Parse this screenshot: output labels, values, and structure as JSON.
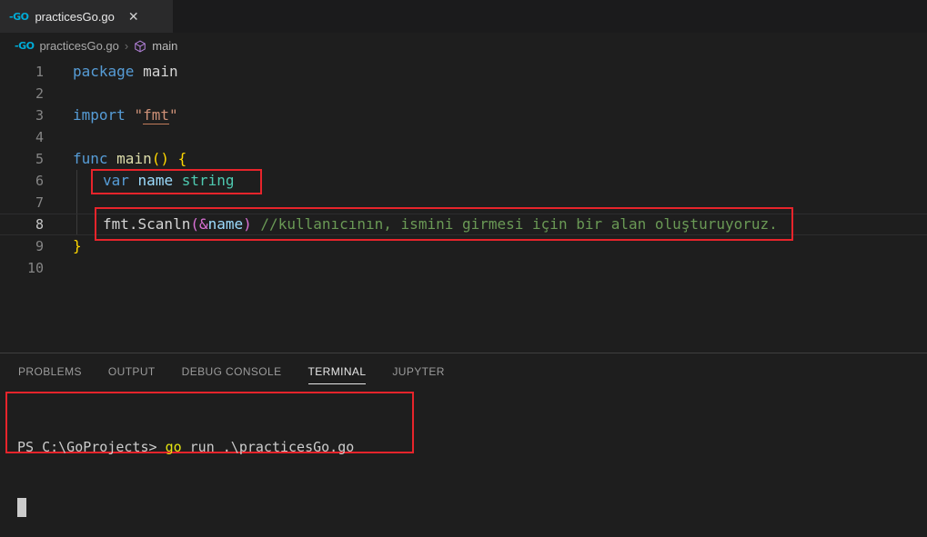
{
  "tab": {
    "filename": "practicesGo.go",
    "close_glyph": "✕",
    "go_icon_text": "-GO"
  },
  "breadcrumb": {
    "file": "practicesGo.go",
    "separator": "›",
    "symbol": "main"
  },
  "editor": {
    "lines": [
      {
        "n": "1",
        "indent": 0,
        "tokens": [
          [
            "kw",
            "package"
          ],
          [
            "pl",
            " "
          ],
          [
            "pl",
            "main"
          ]
        ]
      },
      {
        "n": "2",
        "indent": 0,
        "tokens": []
      },
      {
        "n": "3",
        "indent": 0,
        "tokens": [
          [
            "kw",
            "import"
          ],
          [
            "pl",
            " "
          ],
          [
            "st",
            "\""
          ],
          [
            "stu",
            "fmt"
          ],
          [
            "st",
            "\""
          ]
        ]
      },
      {
        "n": "4",
        "indent": 0,
        "tokens": []
      },
      {
        "n": "5",
        "indent": 0,
        "tokens": [
          [
            "kw",
            "func"
          ],
          [
            "pl",
            " "
          ],
          [
            "fn",
            "main"
          ],
          [
            "b1",
            "()"
          ],
          [
            "pl",
            " "
          ],
          [
            "b1",
            "{"
          ]
        ]
      },
      {
        "n": "6",
        "indent": 1,
        "tokens": [
          [
            "kw",
            "var"
          ],
          [
            "pl",
            " "
          ],
          [
            "id",
            "name"
          ],
          [
            "pl",
            " "
          ],
          [
            "ty",
            "string"
          ]
        ]
      },
      {
        "n": "7",
        "indent": 0,
        "tokens": []
      },
      {
        "n": "8",
        "indent": 1,
        "current": true,
        "tokens": [
          [
            "pl",
            "fmt.Scanln"
          ],
          [
            "b2",
            "("
          ],
          [
            "b2",
            "&"
          ],
          [
            "id",
            "name"
          ],
          [
            "b2",
            ")"
          ],
          [
            "pl",
            " "
          ],
          [
            "cm",
            "//kullanıcının, ismini girmesi için bir alan oluşturuyoruz."
          ]
        ]
      },
      {
        "n": "9",
        "indent": 0,
        "tokens": [
          [
            "b1",
            "}"
          ]
        ]
      },
      {
        "n": "10",
        "indent": 0,
        "tokens": []
      }
    ]
  },
  "panel": {
    "tabs": [
      {
        "label": "PROBLEMS",
        "active": false
      },
      {
        "label": "OUTPUT",
        "active": false
      },
      {
        "label": "DEBUG CONSOLE",
        "active": false
      },
      {
        "label": "TERMINAL",
        "active": true
      },
      {
        "label": "JUPYTER",
        "active": false
      }
    ]
  },
  "terminal": {
    "prompt": "PS C:\\GoProjects> ",
    "command": "go",
    "args": " run .\\practicesGo.go"
  },
  "colors": {
    "annotation_red": "#e7242b",
    "go_brand_cyan": "#00acd7",
    "symbol_purple": "#b180d7",
    "keyword_blue": "#569cd6",
    "type_teal": "#4ec9b0",
    "string_orange": "#ce9178",
    "comment_green": "#6a9955",
    "terminal_command_yellow": "#e5e510"
  }
}
